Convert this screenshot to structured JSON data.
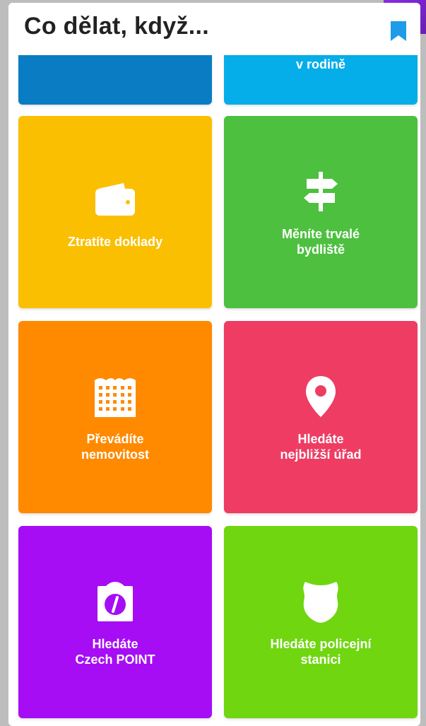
{
  "header": {
    "title": "Co dělat, když...",
    "bookmark_icon": "bookmark-icon"
  },
  "colors": {
    "accent": "#1e9be9",
    "tile_blue_dark": "#0a7cc4",
    "tile_blue_light": "#05aee8",
    "tile_yellow": "#fbbf01",
    "tile_green": "#4dc03f",
    "tile_orange": "#ff8a00",
    "tile_pink": "#ee3c63",
    "tile_purple": "#a60df5",
    "tile_lime": "#6fd610"
  },
  "tiles": [
    {
      "label": "",
      "icon": "",
      "color": "#0a7cc4"
    },
    {
      "label": "v rodině",
      "icon": "",
      "color": "#05aee8"
    },
    {
      "label": "Ztratíte doklady",
      "icon": "wallet-icon",
      "color": "#fbbf01"
    },
    {
      "label": "Měníte trvalé\nbydliště",
      "icon": "signpost-icon",
      "color": "#4dc03f"
    },
    {
      "label": "Převádíte\nnemovitost",
      "icon": "building-icon",
      "color": "#ff8a00"
    },
    {
      "label": "Hledáte\nnejbližší úřad",
      "icon": "map-pin-icon",
      "color": "#ee3c63"
    },
    {
      "label": "Hledáte\nCzech POINT",
      "icon": "czech-point-icon",
      "color": "#a60df5"
    },
    {
      "label": "Hledáte policejní\nstanici",
      "icon": "police-badge-icon",
      "color": "#6fd610"
    }
  ]
}
